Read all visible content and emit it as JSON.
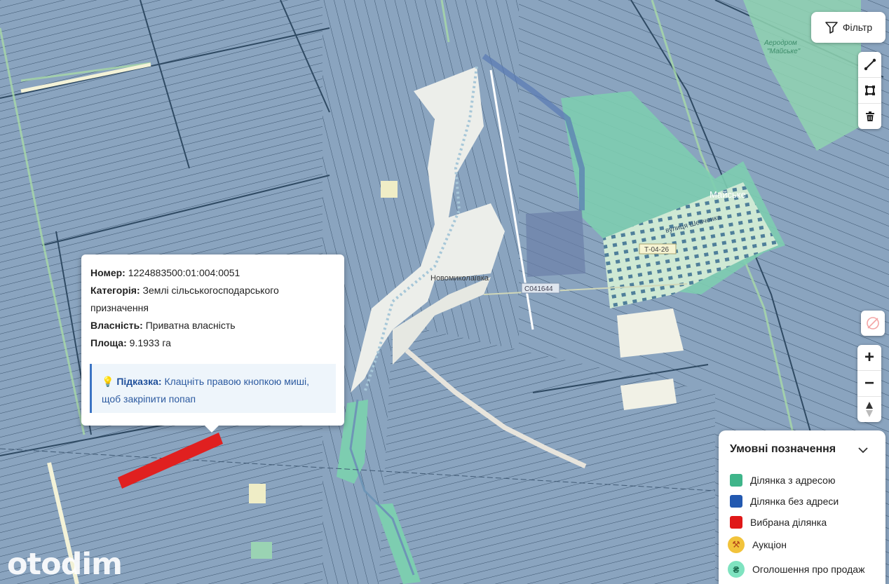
{
  "map": {
    "colors": {
      "parcel_no_address": "#8aa4bf",
      "parcel_line": "#3c556f",
      "address_zone": "#7dcdb0",
      "settlement": "#f1f1ee",
      "selected": "#e02020",
      "road": "#ffffff"
    },
    "labels": {
      "village1": "Новомиколаївка",
      "village2": "Майське",
      "road_code1": "Т-04-26",
      "road_code2": "С041644",
      "airfield_title": "Аеродром",
      "airfield_name": "\"Майське\"",
      "street1": "вулиця Шевченка",
      "street2": "Майська сільська"
    }
  },
  "filter": {
    "label": "Фільтр",
    "icon": "filter-icon"
  },
  "draw_tools": [
    {
      "name": "line-tool-icon"
    },
    {
      "name": "polygon-tool-icon"
    },
    {
      "name": "trash-icon"
    }
  ],
  "popup": {
    "number_label": "Номер:",
    "number_value": "1224883500:01:004:0051",
    "category_label": "Категорія:",
    "category_value_line1": "Землі сільськогосподарського",
    "category_value_line2": "призначення",
    "ownership_label": "Власність:",
    "ownership_value": "Приватна власність",
    "area_label": "Площа:",
    "area_value": "9.1933 га",
    "hint_label": "Підказка:",
    "hint_text_line1": "Клацніть правою кнопкою миші,",
    "hint_text_line2": "щоб закріпити попап"
  },
  "zoom": {
    "in": "+",
    "out": "−"
  },
  "legend": {
    "title": "Умовні позначення",
    "items": [
      {
        "label": "Ділянка з адресою",
        "color": "#3fb58a"
      },
      {
        "label": "Ділянка без адреси",
        "color": "#2359b0"
      },
      {
        "label": "Вибрана ділянка",
        "color": "#e01818"
      },
      {
        "label": "Аукціон",
        "color": "#f2c33b"
      },
      {
        "label": "Оголошення про продаж",
        "color": "#7fe3c0"
      }
    ]
  },
  "branding": {
    "logo": "otodim"
  }
}
